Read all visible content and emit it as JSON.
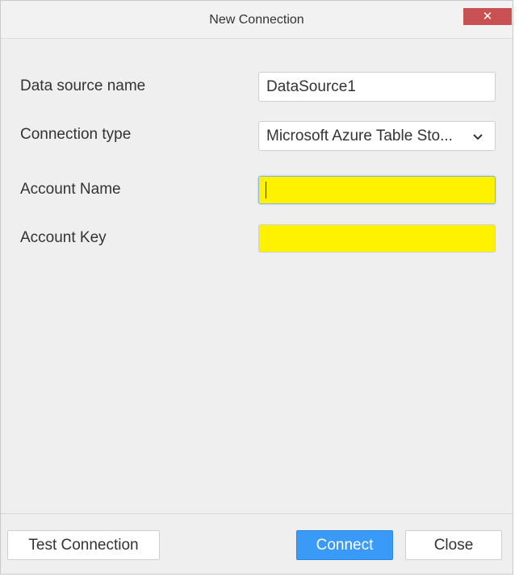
{
  "window": {
    "title": "New Connection",
    "close_glyph": "✕"
  },
  "form": {
    "datasource_label": "Data source name",
    "datasource_value": "DataSource1",
    "connection_type_label": "Connection type",
    "connection_type_value": "Microsoft Azure Table Sto...",
    "account_name_label": "Account Name",
    "account_name_value": "",
    "account_key_label": "Account Key",
    "account_key_value": ""
  },
  "buttons": {
    "test_connection": "Test Connection",
    "connect": "Connect",
    "close": "Close"
  },
  "colors": {
    "required_field": "#fff200",
    "primary": "#3a9af8",
    "close_button": "#c95152"
  },
  "icons": {
    "dropdown": "chevron-down-icon",
    "close": "close-icon"
  }
}
